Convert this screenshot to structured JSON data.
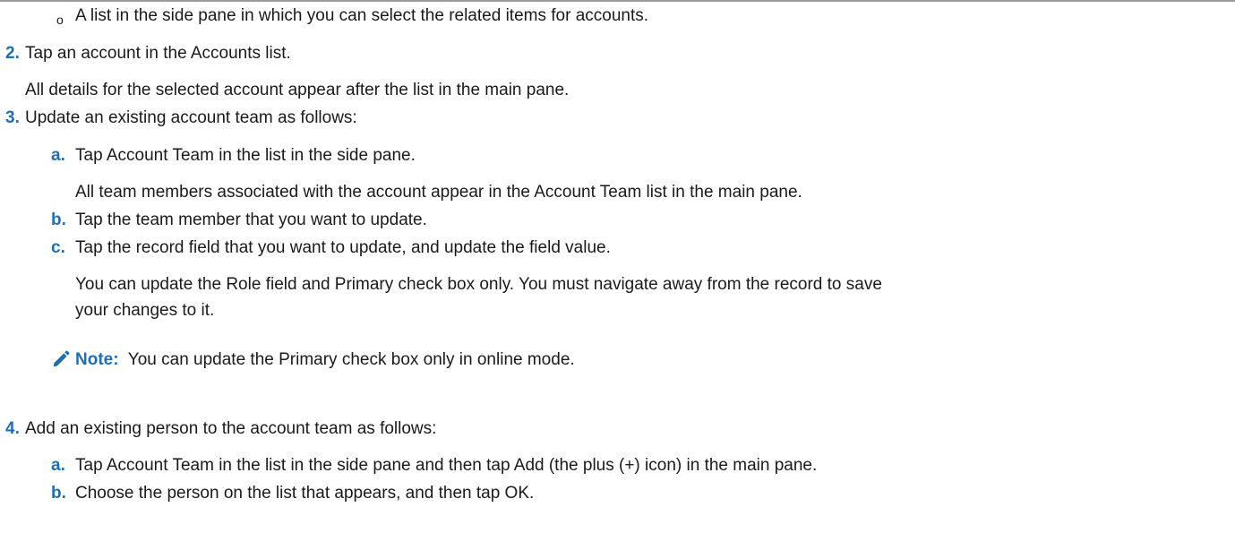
{
  "sub_bullet": {
    "marker": "o",
    "text": "A list in the side pane in which you can select the related items for accounts."
  },
  "steps": [
    {
      "num": "2.",
      "text": "Tap an account in the Accounts list.",
      "result": "All details for the selected account appear after the list in the main pane."
    },
    {
      "num": "3.",
      "text": "Update an existing account team as follows:",
      "substeps": [
        {
          "letter": "a.",
          "text": "Tap Account Team in the list in the side pane.",
          "result": "All team members associated with the account appear in the Account Team list in the main pane."
        },
        {
          "letter": "b.",
          "text": "Tap the team member that you want to update."
        },
        {
          "letter": "c.",
          "text": "Tap the record field that you want to update, and update the field value.",
          "result_line1": "You can update the Role field and Primary check box only. You must navigate away from the record to save",
          "result_line2": "your changes to it."
        }
      ],
      "note": {
        "icon": "pencil-icon",
        "label": "Note:",
        "text": "You can update the Primary check box only in online mode."
      }
    },
    {
      "num": "4.",
      "text": "Add an existing person to the account team as follows:",
      "substeps": [
        {
          "letter": "a.",
          "text": "Tap Account Team in the list in the side pane and then tap Add (the plus (+) icon) in the main pane."
        },
        {
          "letter": "b.",
          "text": "Choose the person on the list that appears, and then tap OK."
        }
      ]
    }
  ],
  "colors": {
    "accent": "#1f6fb0",
    "text": "#1a1a1a",
    "rule": "#9a9a9a"
  }
}
